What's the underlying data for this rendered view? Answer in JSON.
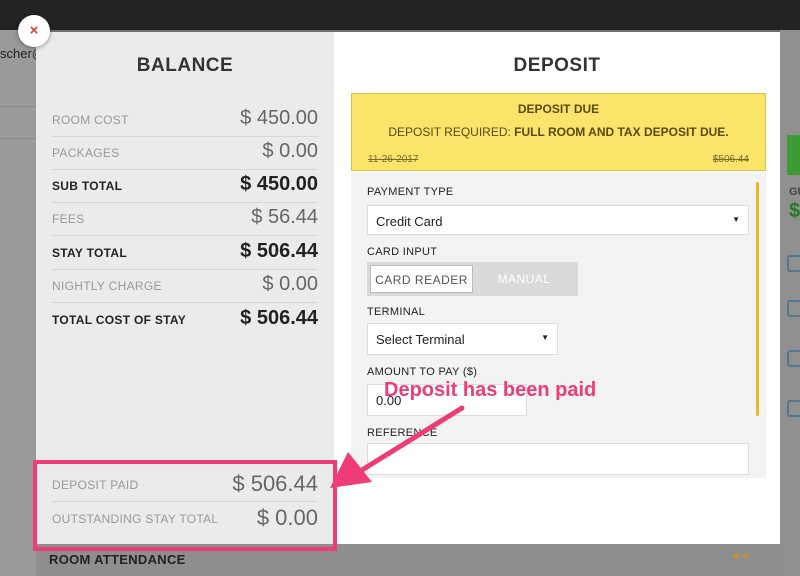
{
  "background": {
    "user_snippet": "scher@",
    "right_label": "GU",
    "right_value": "$",
    "attendance_label": "ROOM ATTENDANCE"
  },
  "close_icon": "×",
  "balance": {
    "title": "BALANCE",
    "rows": [
      {
        "label": "ROOM COST",
        "value": "$ 450.00"
      },
      {
        "label": "PACKAGES",
        "value": "$ 0.00"
      },
      {
        "label": "SUB TOTAL",
        "value": "$ 450.00"
      },
      {
        "label": "FEES",
        "value": "$ 56.44"
      },
      {
        "label": "STAY TOTAL",
        "value": "$ 506.44"
      },
      {
        "label": "NIGHTLY CHARGE",
        "value": "$ 0.00"
      },
      {
        "label": "TOTAL COST OF STAY",
        "value": "$ 506.44"
      }
    ],
    "deposit_paid": {
      "label": "DEPOSIT PAID",
      "value": "$ 506.44"
    },
    "outstanding": {
      "label": "OUTSTANDING STAY TOTAL",
      "value": "$ 0.00"
    }
  },
  "deposit": {
    "title": "DEPOSIT",
    "due": {
      "title": "DEPOSIT DUE",
      "msg_prefix": "DEPOSIT REQUIRED:",
      "msg_bold": "FULL ROOM AND TAX DEPOSIT DUE.",
      "date": "11-26-2017",
      "amount": "$506.44"
    },
    "payment_type_label": "PAYMENT TYPE",
    "payment_type_value": "Credit Card",
    "card_input_label": "CARD INPUT",
    "card_reader_label": "CARD READER",
    "manual_label": "MANUAL",
    "terminal_label": "TERMINAL",
    "terminal_value": "Select Terminal",
    "amount_label": "AMOUNT TO PAY ($)",
    "amount_value": "0.00",
    "reference_label": "REFERENCE",
    "reference_value": ""
  },
  "annotation": {
    "text": "Deposit has been paid",
    "color": "#ef3c77"
  },
  "colors": {
    "annotation": "#ef3c77",
    "due_box": "#fbe46a",
    "scroll_accent": "#e7b926",
    "close": "#d9413a"
  }
}
